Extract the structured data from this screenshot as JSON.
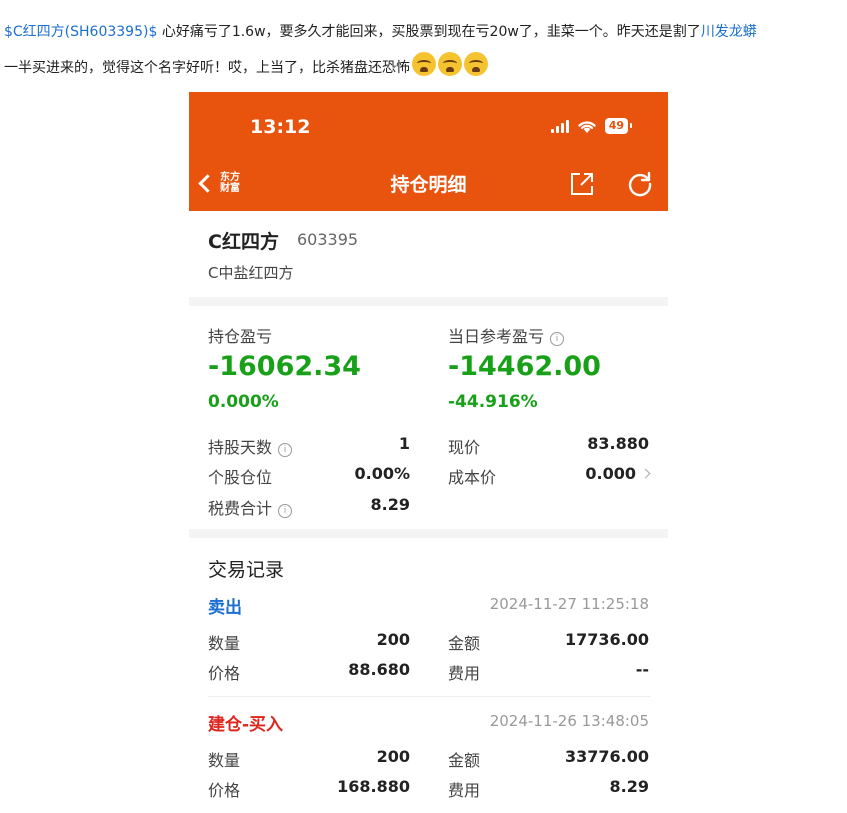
{
  "post": {
    "stock_tag": "$C红四方(SH603395)$",
    "text_part1": " 心好痛亏了1.6w，要多久才能回来，买股票到现在亏20w了，韭菜一个。昨天还是割了",
    "mentioned_stock": "川发龙蟒",
    "text_part2": "一半买进来的，觉得这个名字好听！哎，上当了，比杀猪盘还恐怖"
  },
  "status_bar": {
    "time": "13:12",
    "battery": "49"
  },
  "nav": {
    "logo": "东方财富",
    "title": "持仓明细"
  },
  "stock": {
    "name": "C红四方",
    "code": "603395",
    "sub": "C中盐红四方"
  },
  "pnl": {
    "holding_label": "持仓盈亏",
    "holding_value": "-16062.34",
    "holding_pct": "0.000%",
    "today_label": "当日参考盈亏",
    "today_value": "-14462.00",
    "today_pct": "-44.916%"
  },
  "details": {
    "days_label": "持股天数",
    "days_value": "1",
    "price_label": "现价",
    "price_value": "83.880",
    "position_label": "个股仓位",
    "position_value": "0.00%",
    "cost_label": "成本价",
    "cost_value": "0.000",
    "fee_label": "税费合计",
    "fee_value": "8.29"
  },
  "trades_title": "交易记录",
  "trades": [
    {
      "type": "卖出",
      "time": "2024-11-27 11:25:18",
      "qty_label": "数量",
      "qty": "200",
      "amount_label": "金额",
      "amount": "17736.00",
      "price_label": "价格",
      "price": "88.680",
      "fee_label": "费用",
      "fee": "--"
    },
    {
      "type": "建仓-买入",
      "time": "2024-11-26 13:48:05",
      "qty_label": "数量",
      "qty": "200",
      "amount_label": "金额",
      "amount": "33776.00",
      "price_label": "价格",
      "price": "168.880",
      "fee_label": "费用",
      "fee": "8.29"
    }
  ],
  "colors": {
    "header": "#e8530e",
    "loss_green": "#18a018",
    "sell_blue": "#1a6fd0",
    "buy_red": "#e0251c"
  }
}
